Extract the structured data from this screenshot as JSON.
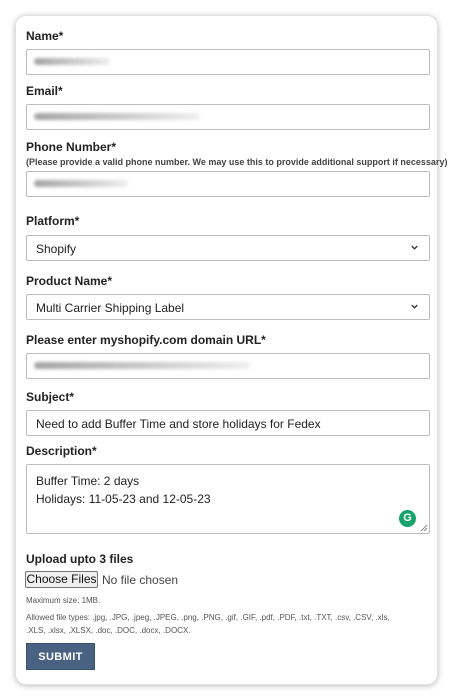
{
  "form": {
    "name": {
      "label": "Name*"
    },
    "email": {
      "label": "Email*"
    },
    "phone": {
      "label": "Phone Number*",
      "hint": "(Please provide a valid phone number. We may use this to provide additional support if necessary)"
    },
    "platform": {
      "label": "Platform*",
      "value": "Shopify"
    },
    "product": {
      "label": "Product Name*",
      "value": "Multi Carrier Shipping Label"
    },
    "domain": {
      "label": "Please enter myshopify.com domain URL*"
    },
    "subject": {
      "label": "Subject*",
      "value": "Need to add Buffer Time and store holidays for Fedex"
    },
    "description": {
      "label": "Description*",
      "line1": "Buffer Time: 2 days",
      "line2": "Holidays: 11-05-23 and 12-05-23"
    },
    "upload": {
      "label": "Upload upto 3 files",
      "button": "Choose Files",
      "status": "No file chosen",
      "max_size": "Maximum size: 1MB.",
      "allowed": "Allowed file types: .jpg, .JPG, .jpeg, .JPEG, .png, .PNG, .gif, .GIF, .pdf, .PDF, .txt, .TXT, .csv, .CSV, .xls,",
      "allowed2": ".XLS, .xlsx, .XLSX, .doc, .DOC, .docx, .DOCX."
    },
    "submit": "SUBMIT"
  },
  "icons": {
    "select_arrow": "chevron-down-icon",
    "grammarly": "grammarly-icon",
    "resize": "resize-handle-icon"
  },
  "colors": {
    "submit_bg": "#4a6282",
    "grammarly": "#15a26b",
    "field_border": "#bdbdbd"
  }
}
